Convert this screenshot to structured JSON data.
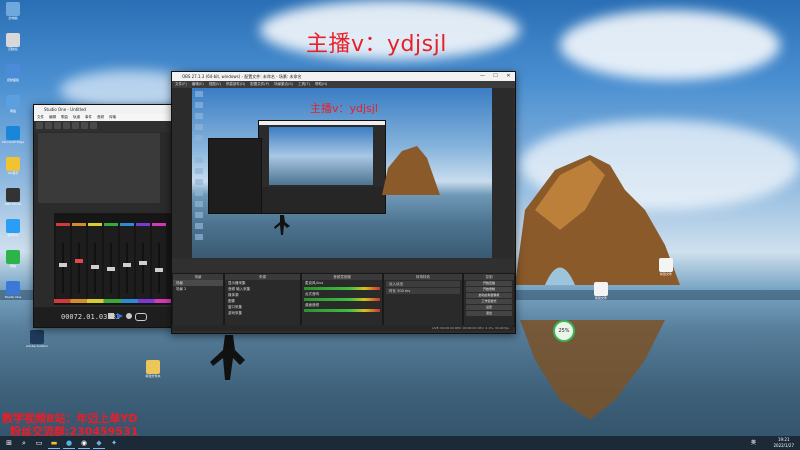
{
  "desktop": {
    "icons": [
      {
        "name": "此电脑",
        "color": "#6fa8dc"
      },
      {
        "name": "回收站",
        "color": "#d8d8d8"
      },
      {
        "name": "控制面板",
        "color": "#4b8bd8"
      },
      {
        "name": "网络",
        "color": "#5aa0e0"
      },
      {
        "name": "Microsoft Edge",
        "color": "#1a86d8"
      },
      {
        "name": "QQ音乐",
        "color": "#f1c232"
      },
      {
        "name": "OBS Studio",
        "color": "#333333"
      },
      {
        "name": "腾讯QQ",
        "color": "#2a9df4"
      },
      {
        "name": "微信",
        "color": "#2cb34a"
      },
      {
        "name": "Studio One",
        "color": "#3c78d8"
      },
      {
        "name": "Adobe Audition",
        "color": "#1f3b5b"
      },
      {
        "name": "新建文件夹",
        "color": "#ecc55b"
      }
    ],
    "right_files": [
      "新建文件",
      "新建文件"
    ]
  },
  "overlay": {
    "streamer_title": "主播v：ydjsjl",
    "line1": "教学视频B站：年迈上单YD",
    "line2": "粉丝交流群:230459531"
  },
  "mixer_window": {
    "title": "Studio One - Untitled",
    "menu": [
      "文件",
      "编辑",
      "歌曲",
      "轨道",
      "事件",
      "音频",
      "传输",
      "视图",
      "Studio One",
      "帮助"
    ],
    "time": "00072.01.03.83",
    "channel_colors": [
      "#d03a3a",
      "#d08f2a",
      "#d4cf2e",
      "#3aa83a",
      "#2e8ad4",
      "#7a3ad4",
      "#d43ab5",
      "#3ad4c8"
    ]
  },
  "obs_window": {
    "title": "OBS 27.1.3 (64-bit, windows) - 配置文件: 未命名 - 场景: 未命名",
    "menu": [
      "文件(F)",
      "编辑(E)",
      "视图(V)",
      "停靠部件(D)",
      "配置文件(P)",
      "场景集合(S)",
      "工具(T)",
      "帮助(H)"
    ],
    "preview_title": "主播v：ydjsjl",
    "docks": {
      "scenes": {
        "header": "场景",
        "items": [
          "场景",
          "场景 2"
        ]
      },
      "sources": {
        "header": "来源",
        "items": [
          "显示器采集",
          "音频 输入采集",
          "媒体源",
          "图像",
          "窗口采集",
          "游戏采集"
        ]
      },
      "mixer": {
        "header": "音频混音器",
        "items": [
          "麦克风/Aux",
          "台式音响",
          "桌面音频"
        ]
      },
      "transitions": {
        "header": "转场特效",
        "items": [
          "淡入淡出",
          "时长 300 ms"
        ]
      },
      "controls": {
        "header": "控制",
        "buttons": [
          "开始直播",
          "开始录制",
          "启动虚拟摄像机",
          "工作室模式",
          "设置",
          "退出"
        ]
      }
    },
    "status": "LIVE: 00:00:00  REC: 00:00:00  CPU: 2.1%, 30.00 fps"
  },
  "taskbar": {
    "items": [
      "windows-logo",
      "search-icon",
      "task-view-icon",
      "explorer-icon",
      "edge-icon",
      "obs-icon",
      "studio-one-icon",
      "qq-icon"
    ],
    "time": "19:21",
    "date": "2022/1/27",
    "lang": "英"
  },
  "badge": {
    "text": "25%"
  }
}
